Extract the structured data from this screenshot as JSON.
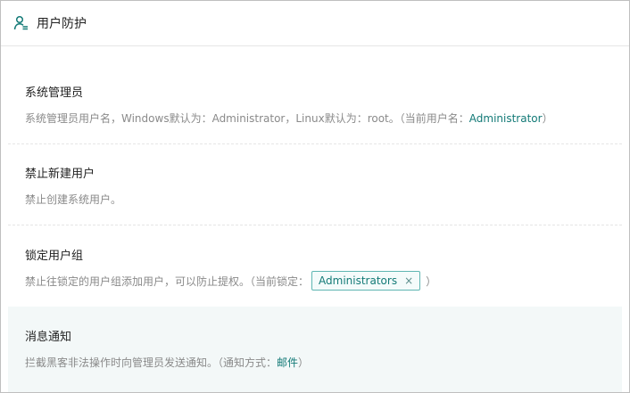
{
  "header": {
    "title": "用户防护",
    "icon": "user-shield-icon",
    "accent_color": "#137a77"
  },
  "sections": [
    {
      "label": "系统管理员",
      "desc_prefix": "系统管理员用户名，Windows默认为：Administrator，Linux默认为：root。（当前用户名：",
      "desc_value": "Administrator",
      "desc_suffix": "）"
    },
    {
      "label": "禁止新建用户",
      "desc": "禁止创建系统用户。"
    },
    {
      "label": "锁定用户组",
      "desc_prefix": "禁止往锁定的用户组添加用户，可以防止提权。（当前锁定：",
      "tag": "Administrators",
      "tag_close": "×",
      "desc_suffix": "）"
    },
    {
      "label": "消息通知",
      "desc_prefix": "拦截黑客非法操作时向管理员发送通知。（通知方式：",
      "desc_value": "邮件",
      "desc_suffix": "）"
    }
  ]
}
